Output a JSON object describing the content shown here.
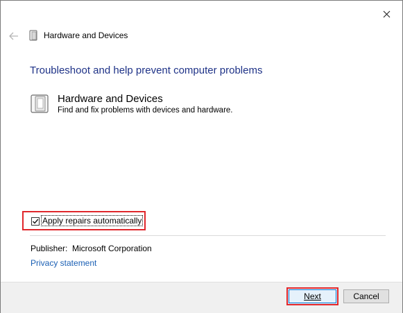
{
  "window": {
    "title": "Hardware and Devices",
    "close_icon": "close-icon",
    "back_icon": "back-arrow-icon"
  },
  "main": {
    "heading": "Troubleshoot and help prevent computer problems",
    "task": {
      "icon": "hardware-devices-icon",
      "title": "Hardware and Devices",
      "description": "Find and fix problems with devices and hardware."
    },
    "options": {
      "apply_repairs_label": "Apply repairs automatically",
      "apply_repairs_checked": true
    },
    "publisher": {
      "label": "Publisher:",
      "value": "Microsoft Corporation"
    },
    "privacy_link": "Privacy statement"
  },
  "footer": {
    "next_label": "Next",
    "cancel_label": "Cancel"
  },
  "colors": {
    "heading": "#1e3287",
    "link": "#1a5fb4",
    "highlight": "#e0262b",
    "footer_bg": "#f0f0f0"
  }
}
